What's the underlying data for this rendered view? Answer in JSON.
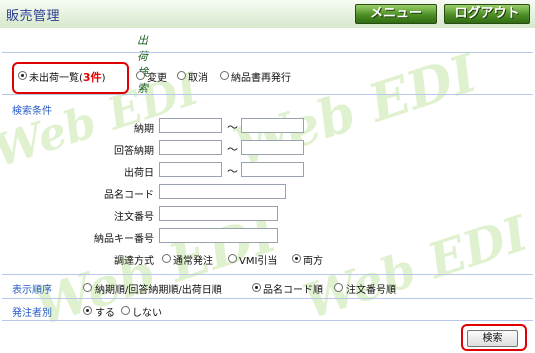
{
  "header": {
    "app_title": "販売管理",
    "menu_button": "メニュー",
    "logout_button": "ログアウト",
    "subtitle": "出荷検索"
  },
  "mode": {
    "options": [
      {
        "label": "未出荷一覧(",
        "count": "3件",
        "suffix": ")",
        "selected": true
      },
      {
        "label": "変更",
        "selected": false
      },
      {
        "label": "取消",
        "selected": false
      },
      {
        "label": "納品書再発行",
        "selected": false
      }
    ]
  },
  "conditions": {
    "section_title": "検索条件",
    "fields": {
      "delivery_date": "納期",
      "answer_date": "回答納期",
      "ship_date": "出荷日",
      "product_code": "品名コード",
      "order_no": "注文番号",
      "delivery_key": "納品キー番号",
      "procurement": "調達方式"
    },
    "range_sep": "～",
    "procurement_options": [
      {
        "label": "通常発注",
        "selected": false
      },
      {
        "label": "VMI引当",
        "selected": false
      },
      {
        "label": "両方",
        "selected": true
      }
    ]
  },
  "sort": {
    "label": "表示順序",
    "options": [
      {
        "label": "納期順/回答納期順/出荷日順",
        "selected": false
      },
      {
        "label": "品名コード順",
        "selected": true
      },
      {
        "label": "注文番号順",
        "selected": false
      }
    ]
  },
  "issuer": {
    "label": "発注者別",
    "options": [
      {
        "label": "する",
        "selected": true
      },
      {
        "label": "しない",
        "selected": false
      }
    ]
  },
  "search_button": "検索",
  "watermark": "Web EDI",
  "colors": {
    "accent": "#2a5bc7",
    "highlight": "#e00000",
    "header_button": "#4d8f25"
  }
}
